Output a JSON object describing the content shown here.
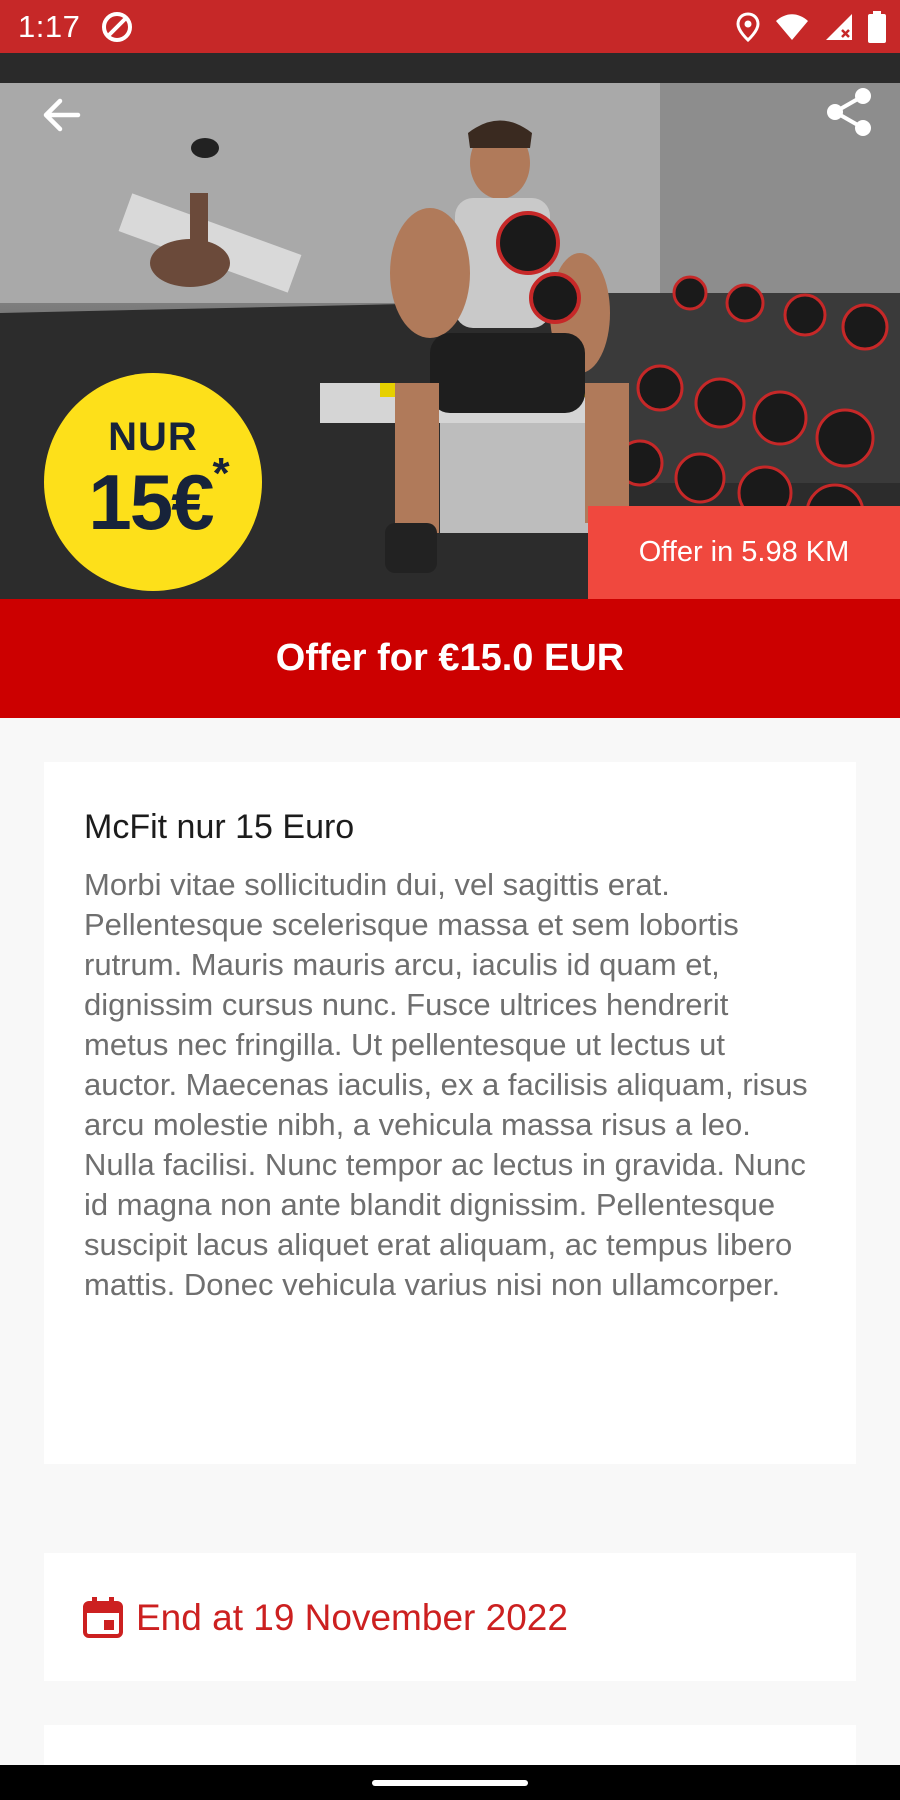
{
  "status_bar": {
    "time": "1:17",
    "icons": [
      "app-notification-icon",
      "location-icon",
      "wifi-icon",
      "cellular-icon",
      "battery-icon"
    ]
  },
  "hero": {
    "back_icon": "arrow-back-icon",
    "share_icon": "share-icon",
    "badge": {
      "top_text": "NUR",
      "price_text": "15€",
      "asterisk": "*"
    },
    "distance_label": "Offer in 5.98 KM"
  },
  "offer_banner": {
    "label": "Offer for €15.0 EUR"
  },
  "description_card": {
    "title": "McFit nur 15 Euro",
    "body": "Morbi vitae sollicitudin dui, vel sagittis erat. Pellentesque scelerisque massa et sem lobortis rutrum. Mauris mauris arcu, iaculis id quam et, dignissim cursus nunc. Fusce ultrices hendrerit metus nec fringilla. Ut pellentesque ut lectus ut auctor. Maecenas iaculis, ex a facilisis aliquam, risus arcu molestie nibh, a vehicula massa risus a leo. Nulla facilisi. Nunc tempor ac lectus in gravida. Nunc id magna non ante blandit dignissim. Pellentesque suscipit lacus aliquet erat aliquam, ac tempus libero mattis. Donec vehicula varius nisi non ullamcorper."
  },
  "date_card": {
    "icon": "calendar-icon",
    "label": "End at 19 November 2022"
  },
  "colors": {
    "status_bar": "#c62828",
    "banner": "#cc0000",
    "distance_pill": "#f0483e",
    "badge": "#fde01a",
    "date_text": "#cc2020"
  }
}
